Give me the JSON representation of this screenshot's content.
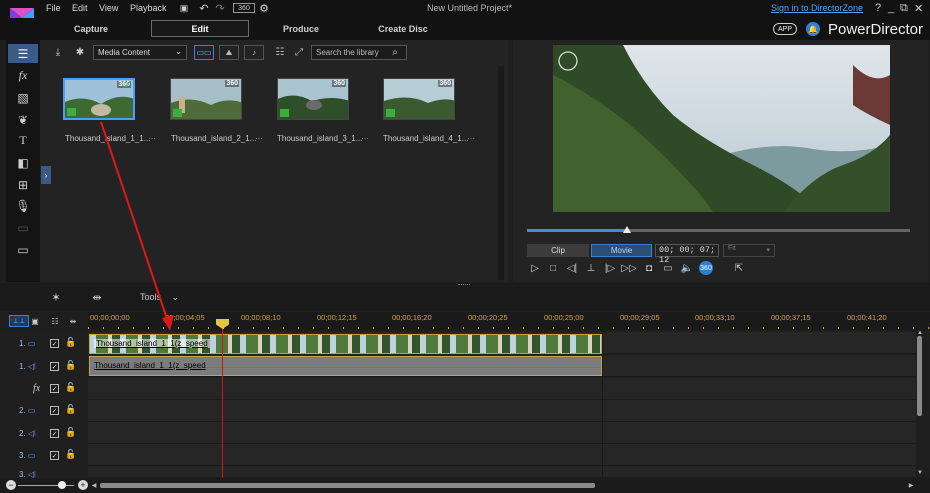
{
  "app": {
    "menu": [
      "File",
      "Edit",
      "View",
      "Playback"
    ],
    "document_title": "New Untitled Project*",
    "signin_link": "Sign in to DirectorZone",
    "brand": "PowerDirector",
    "app_badge": "APP",
    "window_controls": [
      "?",
      "_",
      "⧉",
      "✕"
    ]
  },
  "mode_tabs": [
    "Capture",
    "Edit",
    "Produce",
    "Create Disc"
  ],
  "library": {
    "media_select": "Media Content",
    "search_placeholder": "Search the library",
    "items": [
      {
        "name": "Thousand_island_1_1...",
        "badge": "360",
        "selected": true
      },
      {
        "name": "Thousand_island_2_1...",
        "badge": "360",
        "selected": false
      },
      {
        "name": "Thousand_island_3_1...",
        "badge": "360",
        "selected": false
      },
      {
        "name": "Thousand_island_4_1...",
        "badge": "360",
        "selected": false
      }
    ]
  },
  "preview": {
    "mode_clip": "Clip",
    "mode_movie": "Movie",
    "timecode": "00; 00; 07; 12",
    "fit": "Fit",
    "progress_fraction": 0.26
  },
  "midbar": {
    "tools_label": "Tools"
  },
  "timeline": {
    "ruler_labels": [
      "00;00;00;00",
      "00;00;04;05",
      "00;00;08;10",
      "00;00;12;15",
      "00;00;16;20",
      "00;00;20;25",
      "00;00;25;00",
      "00;00;29;05",
      "00;00;33;10",
      "00;00;37;15",
      "00;00;41;20"
    ],
    "tracks": [
      "1.",
      "1.",
      "fx",
      "2.",
      "2.",
      "3.",
      "3."
    ],
    "video_clip_name": "Thousand_island_1_1(z_speed",
    "audio_clip_name": "Thousand_island_1_1(z_speed"
  },
  "colors": {
    "accent": "#3f8ee0",
    "ruler_text": "#d6a53a",
    "playhead": "#d01414",
    "annotation_arrow": "#e01818"
  }
}
